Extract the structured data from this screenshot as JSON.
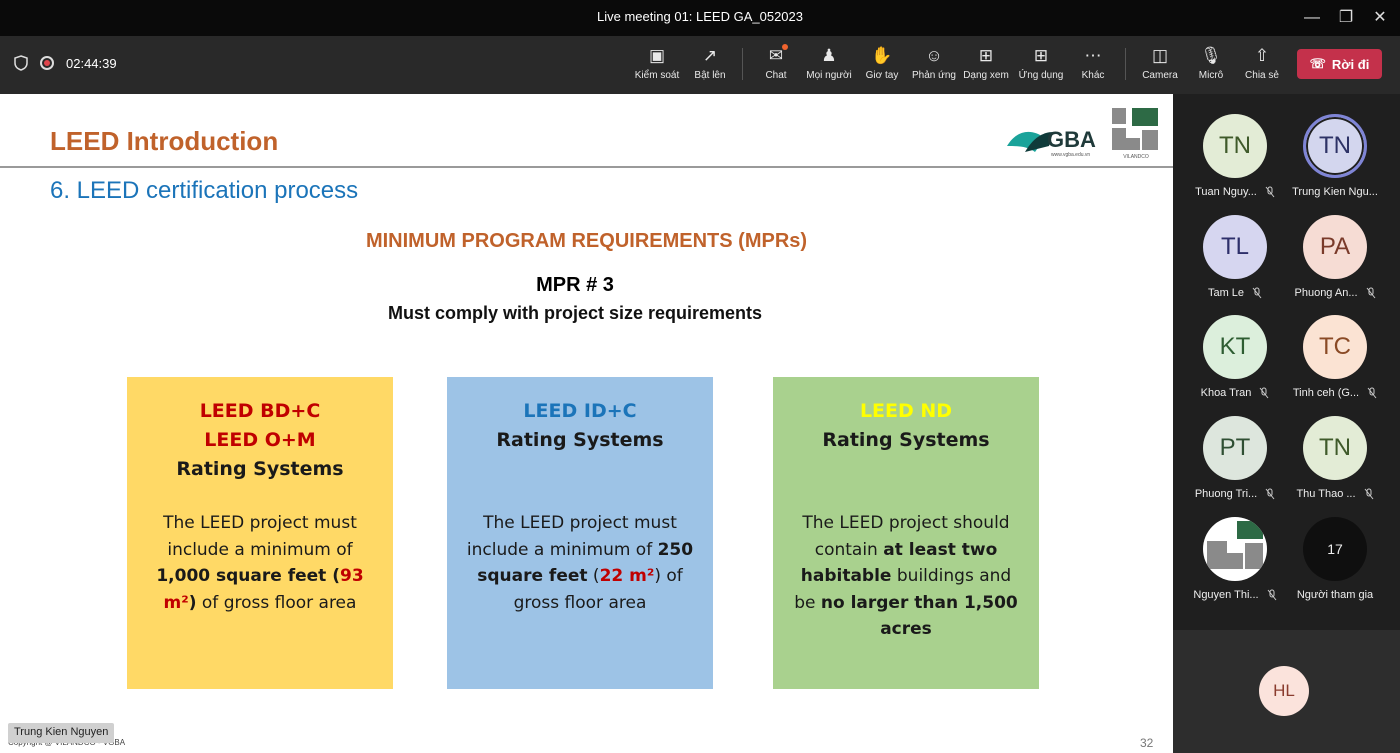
{
  "window": {
    "title": "Live meeting 01: LEED GA_052023"
  },
  "toolbar": {
    "timer": "02:44:39",
    "buttons": [
      {
        "icon": "screen-share-control-icon",
        "label": "Kiểm soát"
      },
      {
        "icon": "share-up-icon",
        "label": "Bật lên"
      },
      {
        "icon": "chat-icon",
        "label": "Chat"
      },
      {
        "icon": "people-icon",
        "label": "Mọi người"
      },
      {
        "icon": "raise-hand-icon",
        "label": "Giơ tay"
      },
      {
        "icon": "react-icon",
        "label": "Phản ứng"
      },
      {
        "icon": "view-icon",
        "label": "Dạng xem"
      },
      {
        "icon": "apps-icon",
        "label": "Ứng dụng"
      },
      {
        "icon": "more-icon",
        "label": "Khác"
      },
      {
        "icon": "camera-off-icon",
        "label": "Camera"
      },
      {
        "icon": "mic-off-icon",
        "label": "Micrô"
      },
      {
        "icon": "share-icon",
        "label": "Chia sẻ"
      }
    ],
    "leave_label": "Rời đi"
  },
  "slide": {
    "title": "LEED Introduction",
    "subtitle": "6. LEED certification process",
    "heading": "MINIMUM PROGRAM REQUIREMENTS (MPRs)",
    "mpr_number": "MPR # 3",
    "mpr_desc": "Must comply with project size requirements",
    "logo_text": "GBA",
    "logo_url": "www.vgba.edu.vn",
    "logo2_text": "VILANDCO",
    "boxes": [
      {
        "line1": "LEED BD+C",
        "line2": "LEED O+M",
        "rating": "Rating Systems",
        "body_a": "The LEED project must include a minimum of ",
        "body_bold": "1,000 square feet",
        "body_paren_open": " (",
        "body_red": "93 m²",
        "body_paren_close": ")",
        "body_b": " of gross floor area"
      },
      {
        "line1": "LEED ID+C",
        "rating": "Rating Systems",
        "body_a": "The LEED project must include a minimum of ",
        "body_bold": "250 square feet",
        "body_paren_open": " (",
        "body_red": "22 m²",
        "body_paren_close": ")",
        "body_b": " of gross floor area"
      },
      {
        "line1": "LEED ND",
        "rating": "Rating Systems",
        "body_a": "The LEED project should contain ",
        "body_bold": "at least two habitable",
        "body_mid": " buildings and be ",
        "body_bold2": "no larger than 1,500 acres"
      }
    ],
    "footer": "Copyright @ VILANDCO - VGBA",
    "page_number": "32",
    "presenter": "Trung Kien Nguyen"
  },
  "participants": [
    {
      "initials": "TN",
      "name": "Tuan Nguy...",
      "bg": "#e3ecd6",
      "fg": "#3f5a2a"
    },
    {
      "initials": "TN",
      "name": "Trung Kien Ngu...",
      "bg": "#d3d6ee",
      "fg": "#2d3266"
    },
    {
      "initials": "TL",
      "name": "Tam Le",
      "bg": "#d6d6f0",
      "fg": "#2d2f6a"
    },
    {
      "initials": "PA",
      "name": "Phuong An...",
      "bg": "#f6dcd4",
      "fg": "#7a3a2a"
    },
    {
      "initials": "KT",
      "name": "Khoa Tran",
      "bg": "#dcefdc",
      "fg": "#2e5d32"
    },
    {
      "initials": "TC",
      "name": "Tinh ceh (G...",
      "bg": "#fbe3d3",
      "fg": "#8a4a25"
    },
    {
      "initials": "PT",
      "name": "Phuong Tri...",
      "bg": "#dde6dd",
      "fg": "#2f4f33"
    },
    {
      "initials": "TN",
      "name": "Thu Thao ...",
      "bg": "#e3ecd6",
      "fg": "#3f5a2a"
    },
    {
      "initials": "",
      "name": "Nguyen Thi...",
      "bg": "#ffffff",
      "fg": "#333"
    },
    {
      "initials": "17",
      "name": "Người tham gia",
      "bg": "#0f0f0f",
      "fg": "#eee"
    }
  ],
  "bottom_tile": {
    "initials": "HL"
  }
}
